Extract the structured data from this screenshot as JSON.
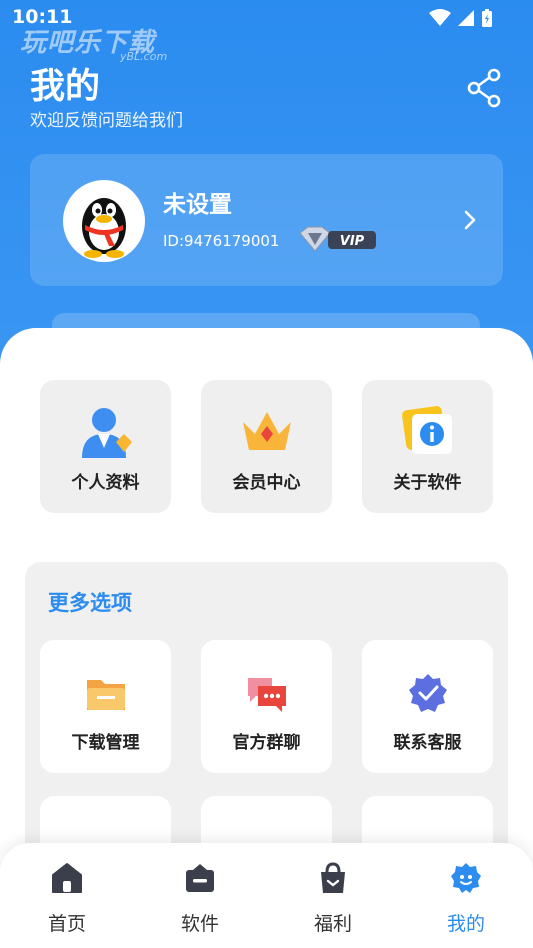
{
  "status": {
    "time": "10:11"
  },
  "watermark": {
    "text": "玩吧乐下载",
    "sub": "yBL.com"
  },
  "header": {
    "title": "我的",
    "subtitle": "欢迎反馈问题给我们"
  },
  "profile": {
    "name": "未设置",
    "id": "ID:9476179001",
    "vip_label": "VIP"
  },
  "quick": [
    {
      "label": "个人资料",
      "icon": "user-profile-icon"
    },
    {
      "label": "会员中心",
      "icon": "crown-icon"
    },
    {
      "label": "关于软件",
      "icon": "info-icon"
    }
  ],
  "more": {
    "title": "更多选项",
    "items": [
      {
        "label": "下载管理",
        "icon": "folder-icon"
      },
      {
        "label": "官方群聊",
        "icon": "chat-bubbles-icon"
      },
      {
        "label": "联系客服",
        "icon": "verified-badge-icon"
      }
    ]
  },
  "nav": [
    {
      "label": "首页",
      "icon": "home-icon"
    },
    {
      "label": "软件",
      "icon": "apps-icon"
    },
    {
      "label": "福利",
      "icon": "bag-icon"
    },
    {
      "label": "我的",
      "icon": "profile-icon",
      "active": true
    }
  ],
  "colors": {
    "primary": "#2d8cf0",
    "tile_bg": "#efefef"
  }
}
